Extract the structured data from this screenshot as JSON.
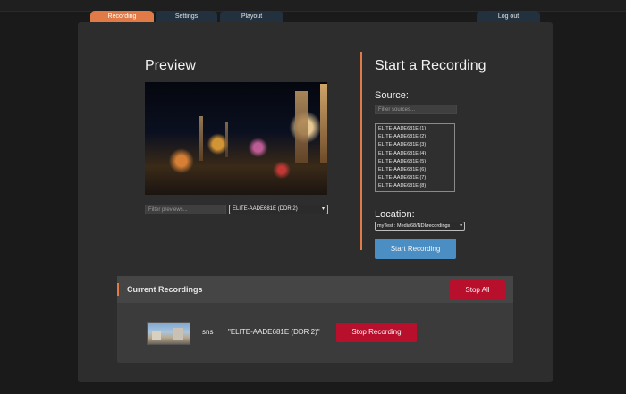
{
  "tabs": {
    "recording": "Recording",
    "settings": "Settings",
    "playout": "Playout",
    "logout": "Log out"
  },
  "preview": {
    "title": "Preview",
    "filter_placeholder": "Filter previews...",
    "selected_source": "ELITE-AADE681E (DDR 2)"
  },
  "recording": {
    "title": "Start a Recording",
    "source_label": "Source:",
    "filter_placeholder": "Filter sources...",
    "sources": [
      "ELITE-AADE681E (1)",
      "ELITE-AADE681E (2)",
      "ELITE-AADE681E (3)",
      "ELITE-AADE681E (4)",
      "ELITE-AADE681E (5)",
      "ELITE-AADE681E (6)",
      "ELITE-AADE681E (7)",
      "ELITE-AADE681E (8)"
    ],
    "location_label": "Location:",
    "location_value": "myTest : Media68/NDI/recordings",
    "start_button": "Start Recording"
  },
  "current": {
    "title": "Current Recordings",
    "stop_all": "Stop All",
    "items": [
      {
        "name": "sns",
        "source": "\"ELITE-AADE681E (DDR 2)\"",
        "stop_label": "Stop Recording"
      }
    ]
  },
  "colors": {
    "accent": "#e07b48",
    "primary_button": "#4a8ec4",
    "danger_button": "#b8102c"
  }
}
